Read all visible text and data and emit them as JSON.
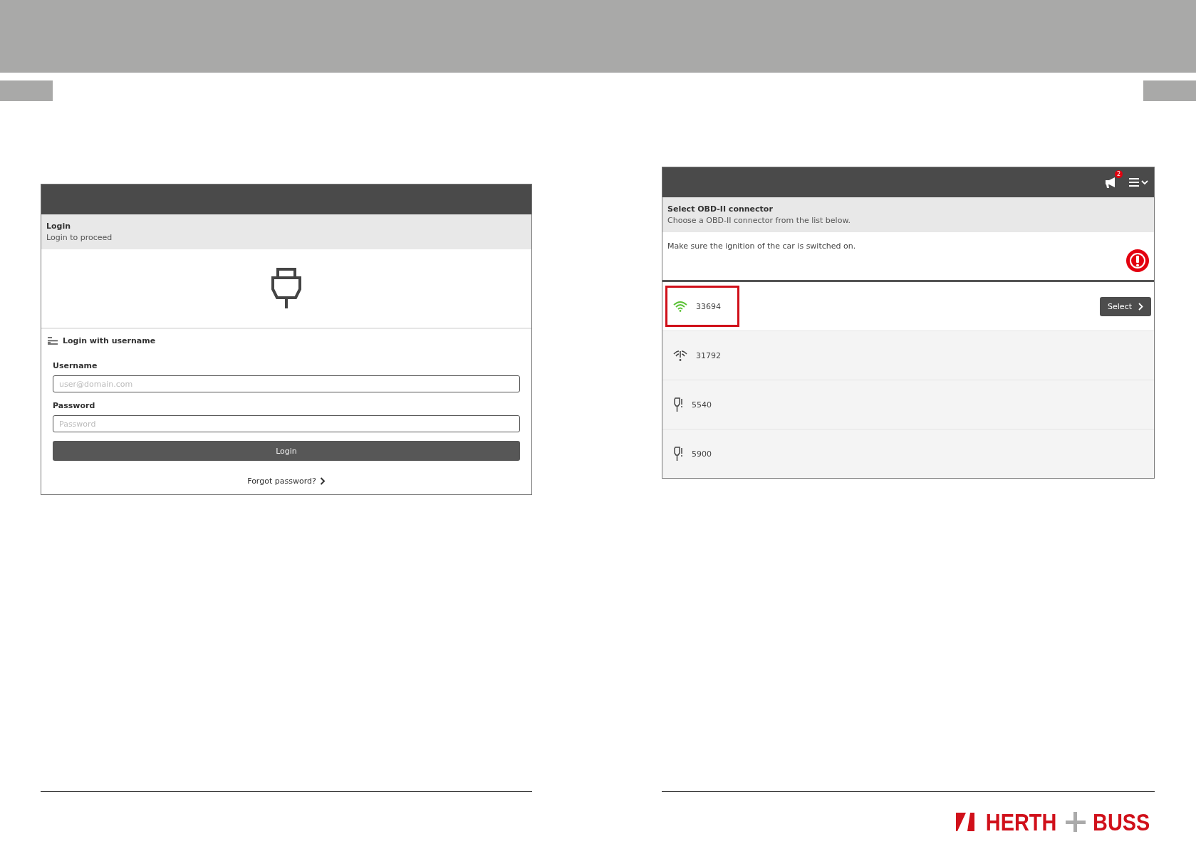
{
  "login_screen": {
    "header": {
      "title": "Login",
      "subtitle": "Login to proceed"
    },
    "section_title": "Login with username",
    "fields": [
      {
        "label": "Username",
        "placeholder": "user@domain.com"
      },
      {
        "label": "Password",
        "placeholder": "Password"
      }
    ],
    "login_button": "Login",
    "forgot_link": "Forgot password?"
  },
  "connector_screen": {
    "notification_count": "2",
    "header": {
      "title": "Select OBD-II connector",
      "subtitle": "Choose a OBD-II connector from the list below."
    },
    "notice": "Make sure the ignition of the car is switched on.",
    "connectors": [
      {
        "kind": "wifi",
        "name": "33694",
        "selected": true
      },
      {
        "kind": "wifi-off",
        "name": "31792",
        "selected": false
      },
      {
        "kind": "cable",
        "name": "5540",
        "selected": false
      },
      {
        "kind": "cable",
        "name": "5900",
        "selected": false
      }
    ],
    "select_button": "Select"
  },
  "logo": {
    "left": "HERTH",
    "right": "BUSS"
  }
}
